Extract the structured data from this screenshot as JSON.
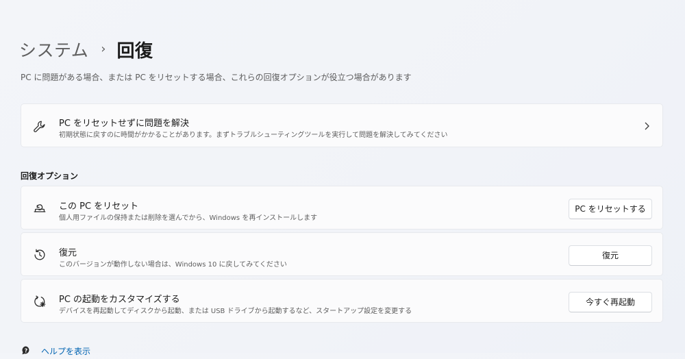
{
  "breadcrumb": {
    "parent": "システム",
    "separator": "›",
    "current": "回復"
  },
  "page": {
    "description": "PC に問題がある場合、または PC をリセットする場合、これらの回復オプションが役立つ場合があります"
  },
  "troubleshoot": {
    "title": "PC をリセットせずに問題を解決",
    "subtitle": "初期状態に戻すのに時間がかかることがあります。まずトラブルシューティングツールを実行して問題を解決してみてください",
    "icon": "wrench-icon"
  },
  "recovery_options": {
    "heading": "回復オプション",
    "items": [
      {
        "title": "この PC をリセット",
        "subtitle": "個人用ファイルの保持または削除を選んでから、Windows を再インストールします",
        "button": "PC をリセットする",
        "icon": "reset-pc-icon"
      },
      {
        "title": "復元",
        "subtitle": "このバージョンが動作しない場合は、Windows 10 に戻してみてください",
        "button": "復元",
        "icon": "history-icon"
      },
      {
        "title": "PC の起動をカスタマイズする",
        "subtitle": "デバイスを再起動してディスクから起動、または USB ドライブから起動するなど、スタートアップ設定を変更する",
        "button": "今すぐ再起動",
        "icon": "advanced-startup-icon"
      }
    ]
  },
  "help": {
    "link": "ヘルプを表示",
    "icon": "help-icon"
  },
  "colors": {
    "background": "#f2f4f8",
    "card": "#fbfbfc",
    "link": "#0063b1"
  }
}
